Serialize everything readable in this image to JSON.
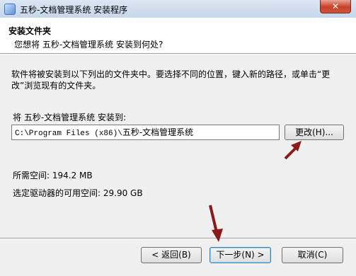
{
  "window": {
    "title": "五秒-文档管理系统 安装程序",
    "close_glyph": "✕"
  },
  "header": {
    "title": "安装文件夹",
    "subtitle": "您想将 五秒-文档管理系统 安装到何处?"
  },
  "body": {
    "description": "软件将被安装到以下列出的文件夹中。要选择不同的位置，键入新的路径，或单击“更改”浏览现有的文件夹。",
    "install_label": "将 五秒-文档管理系统 安装到:",
    "path_prefix": "C:\\Program Files (x86)\\",
    "path_suffix": "五秒-文档管理系统",
    "change_button": "更改(H)...",
    "space_required": "所需空间: 194.2 MB",
    "space_available": "选定驱动器的可用空间: 29.90 GB"
  },
  "footer": {
    "back_button": "< 返回(B)",
    "next_button": "下一步(N) >",
    "cancel_button": "取消(C)"
  },
  "colors": {
    "annotation_arrow": "#8b1a1a"
  }
}
